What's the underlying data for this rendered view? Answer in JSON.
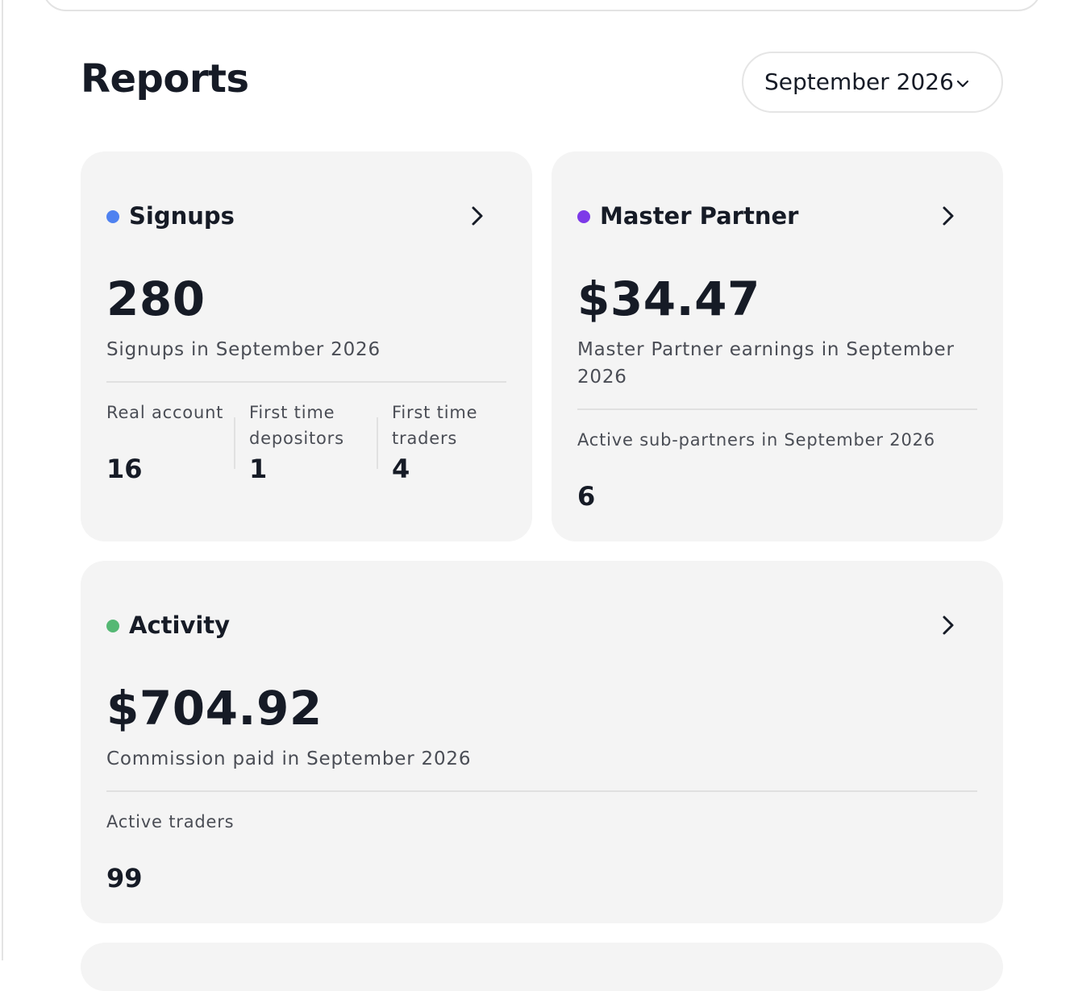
{
  "page": {
    "title": "Reports",
    "month_selector": {
      "value": "September 2026",
      "icon": "chevron-down-icon"
    }
  },
  "colors": {
    "signups_dot": "#4f82f0",
    "master_partner_dot": "#7d3ae8",
    "activity_dot": "#55b874",
    "card_background": "#f4f4f4",
    "text_primary": "#161b26"
  },
  "signups": {
    "title": "Signups",
    "value": "280",
    "description": "Signups in September 2026",
    "stats": [
      {
        "label": "Real account",
        "value": "16"
      },
      {
        "label": "First time depositors",
        "value": "1"
      },
      {
        "label": "First time traders",
        "value": "4"
      }
    ]
  },
  "master_partner": {
    "title": "Master Partner",
    "value": "$34.47",
    "description": "Master Partner earnings in September 2026",
    "stat_label": "Active sub-partners in September 2026",
    "stat_value": "6"
  },
  "activity": {
    "title": "Activity",
    "value": "$704.92",
    "description": "Commission paid in September 2026",
    "stat_label": "Active traders",
    "stat_value": "99"
  }
}
